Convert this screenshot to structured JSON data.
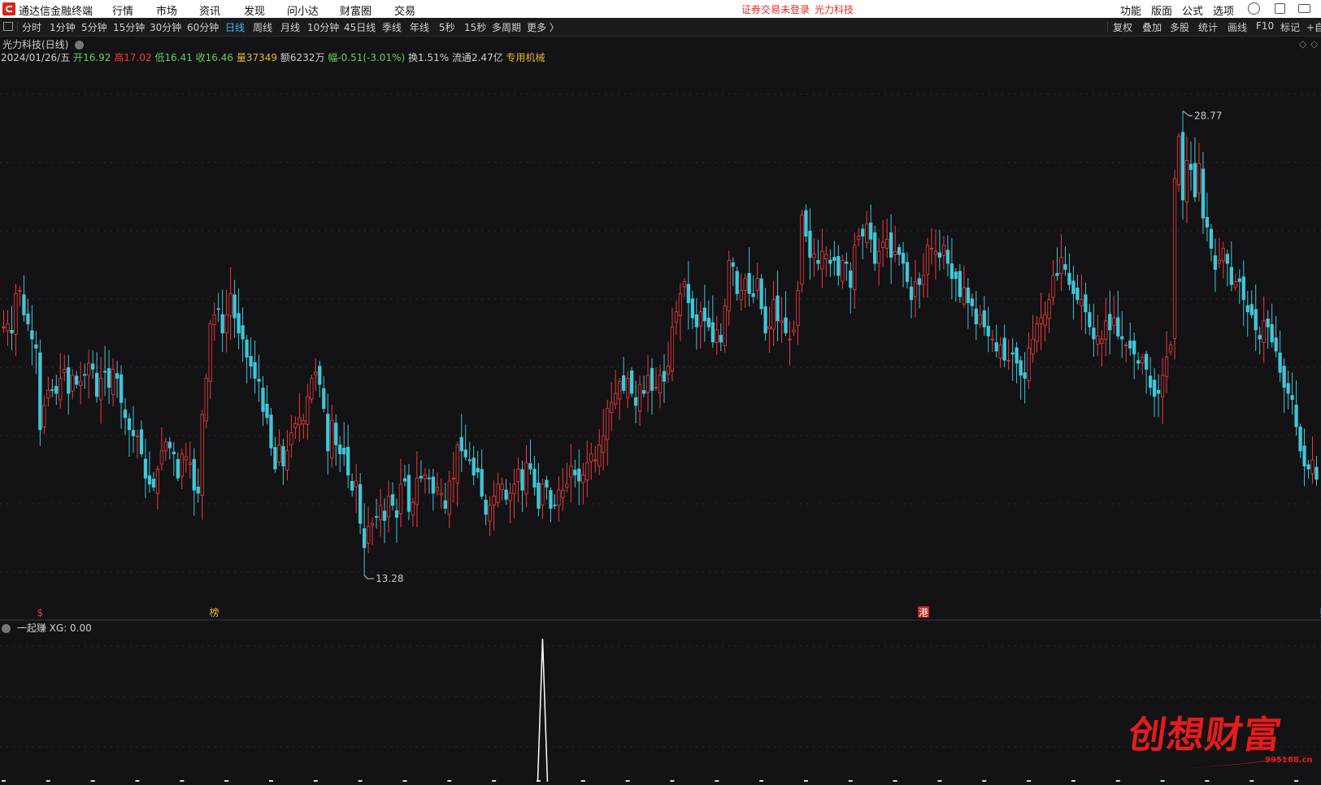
{
  "titlebar": {
    "app_title": "通达信金融终端",
    "menus": [
      "行情",
      "市场",
      "资讯",
      "发现",
      "问小达",
      "财富圈",
      "交易"
    ],
    "alert_login": "证券交易未登录",
    "alert_stock": "光力科技",
    "right_menus": [
      "功能",
      "版面",
      "公式",
      "选项"
    ]
  },
  "period_bar": {
    "items": [
      "分时",
      "1分钟",
      "5分钟",
      "15分钟",
      "30分钟",
      "60分钟",
      "日线",
      "周线",
      "月线",
      "10分钟",
      "45日线",
      "季线",
      "年线",
      "5秒",
      "15秒",
      "多周期",
      "更多 〉"
    ],
    "active": "日线",
    "right_items": [
      "复权",
      "叠加",
      "多股",
      "统计",
      "画线",
      "F10",
      "标记",
      "+自"
    ]
  },
  "stock": {
    "name_period": "光力科技(日线)",
    "date": "2024/01/26/五",
    "open_label": "开",
    "open": "16.92",
    "high_label": "高",
    "high": "17.02",
    "low_label": "低",
    "low": "16.41",
    "close_label": "收",
    "close": "16.46",
    "volume_label": "量",
    "volume": "37349",
    "amount_label": "额",
    "amount": "6232万",
    "change_label": "幅",
    "change": "-0.51(-3.01%)",
    "turnover_label": "换",
    "turnover": "1.51%",
    "float_label": "流通",
    "float_cap": "2.47亿",
    "industry": "专用机械"
  },
  "indicator": {
    "name": "一起赚",
    "value_text": "XG: 0.00"
  },
  "watermark": {
    "brand": "创想财富",
    "site": "995168.cn"
  },
  "colors": {
    "up": "#f03c3c",
    "down": "#3fc7d8",
    "background": "#131215",
    "grid": "#3a2a2a"
  },
  "chart_data": {
    "type": "candlestick",
    "period": "日线",
    "price_annotations": {
      "high_marker": "28.77",
      "low_marker": "13.28"
    },
    "y_range": [
      12.8,
      30.0
    ],
    "event_markers": [
      {
        "label": "$",
        "bar": 9
      },
      {
        "label": "榜",
        "bar": 52
      },
      {
        "label": "港",
        "bar": 227
      },
      {
        "label": "财",
        "bar": 326
      },
      {
        "label": "$",
        "bar": 334
      }
    ],
    "closes": [
      21.5,
      21.6,
      21.3,
      22.6,
      22.7,
      21.9,
      21.6,
      21.1,
      20.8,
      18.1,
      18.9,
      19.4,
      19.4,
      19.3,
      19.8,
      20.1,
      19.3,
      19.9,
      19.6,
      19.7,
      19.9,
      20.3,
      20.1,
      19.2,
      19.8,
      20.0,
      19.5,
      20.1,
      19.8,
      19.0,
      18.5,
      18.1,
      17.9,
      17.9,
      17.3,
      16.5,
      16.3,
      16.2,
      16.8,
      17.4,
      17.7,
      17.5,
      17.3,
      16.5,
      17.3,
      17.2,
      17.0,
      16.1,
      16.0,
      18.6,
      19.8,
      21.6,
      21.9,
      22.1,
      21.3,
      21.9,
      22.6,
      21.8,
      21.3,
      21.1,
      20.5,
      20.2,
      19.8,
      19.7,
      18.7,
      18.5,
      17.5,
      16.8,
      17.6,
      16.9,
      17.4,
      18.0,
      18.3,
      18.5,
      18.4,
      19.2,
      19.8,
      20.0,
      19.6,
      18.8,
      17.4,
      18.4,
      17.6,
      17.3,
      17.3,
      16.6,
      16.1,
      16.4,
      15.0,
      14.2,
      14.9,
      15.0,
      15.2,
      15.6,
      15.1,
      15.9,
      15.6,
      15.2,
      16.3,
      16.4,
      15.4,
      15.7,
      16.5,
      16.5,
      16.6,
      16.5,
      16.0,
      16.2,
      16.0,
      15.5,
      16.4,
      16.5,
      17.6,
      17.4,
      17.2,
      17.1,
      16.6,
      16.7,
      15.9,
      15.3,
      15.6,
      15.9,
      16.3,
      16.3,
      15.8,
      16.0,
      16.3,
      16.8,
      16.1,
      17.0,
      16.8,
      16.2,
      15.5,
      16.3,
      16.2,
      15.5,
      15.6,
      16.1,
      16.1,
      16.3,
      16.9,
      16.6,
      16.4,
      16.6,
      17.0,
      17.3,
      17.1,
      17.6,
      17.9,
      18.8,
      19.0,
      19.3,
      19.7,
      19.4,
      19.8,
      19.3,
      18.9,
      19.6,
      19.3,
      19.9,
      19.4,
      19.5,
      19.9,
      19.7,
      20.2,
      21.5,
      22.0,
      22.6,
      23.0,
      22.3,
      21.8,
      21.5,
      22.0,
      21.7,
      21.5,
      21.0,
      21.4,
      21.0,
      22.2,
      23.7,
      23.5,
      22.6,
      22.7,
      23.1,
      22.6,
      22.5,
      23.1,
      22.1,
      21.3,
      21.5,
      22.4,
      21.7,
      21.7,
      21.3,
      21.1,
      21.4,
      22.7,
      25.2,
      24.5,
      23.8,
      23.9,
      23.6,
      24.0,
      23.9,
      23.6,
      23.7,
      23.2,
      23.7,
      23.6,
      22.8,
      24.2,
      24.5,
      24.5,
      24.9,
      24.4,
      23.6,
      24.0,
      24.3,
      24.4,
      23.8,
      24.0,
      23.9,
      23.6,
      23.0,
      22.4,
      23.0,
      22.9,
      23.2,
      24.2,
      24.1,
      24.0,
      23.8,
      24.2,
      23.6,
      23.1,
      23.1,
      22.5,
      22.8,
      22.3,
      22.2,
      21.6,
      21.9,
      21.5,
      21.2,
      21.1,
      20.7,
      20.9,
      20.4,
      20.4,
      20.6,
      20.3,
      19.9,
      19.8,
      20.8,
      21.1,
      21.6,
      21.8,
      21.9,
      22.4,
      23.2,
      23.2,
      23.8,
      23.4,
      22.9,
      22.6,
      22.4,
      22.4,
      22.0,
      21.5,
      21.1,
      21.2,
      21.1,
      21.7,
      21.4,
      21.8,
      21.2,
      21.1,
      20.9,
      20.8,
      20.6,
      20.3,
      20.5,
      20.1,
      19.5,
      19.2,
      19.3,
      19.9,
      20.5,
      20.9,
      26.4,
      27.8,
      25.7,
      27.0,
      26.7,
      25.8,
      26.9,
      25.1,
      24.8,
      24.1,
      23.4,
      23.7,
      24.1,
      23.6,
      22.9,
      23.0,
      23.0,
      22.4,
      22.0,
      21.9,
      21.4,
      21.1,
      21.7,
      21.5,
      21.0,
      20.7,
      20.0,
      19.5,
      19.3,
      19.1,
      18.2,
      17.4,
      16.9,
      16.8,
      17.1,
      16.46
    ],
    "indicator_spike_bar": 133,
    "indicator_spike_value": 1
  }
}
